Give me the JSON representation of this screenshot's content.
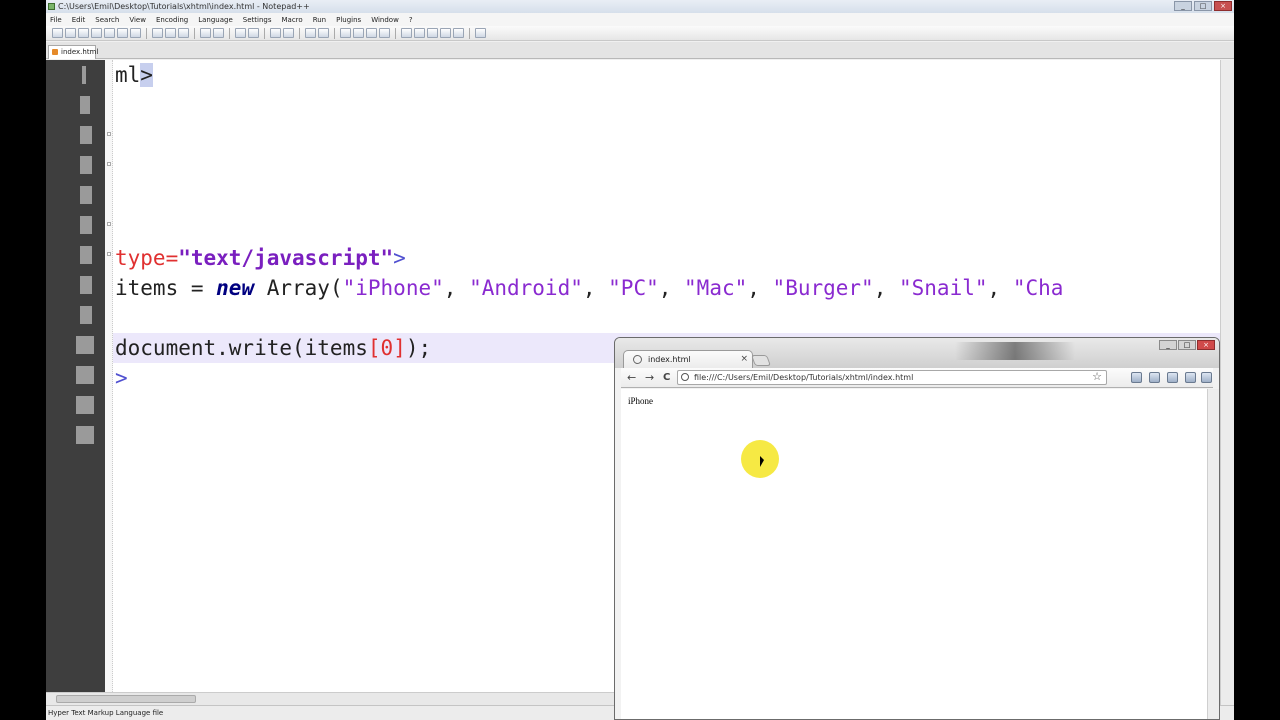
{
  "npp": {
    "title": "C:\\Users\\Emil\\Desktop\\Tutorials\\xhtml\\index.html - Notepad++",
    "menu": [
      "File",
      "Edit",
      "Search",
      "View",
      "Encoding",
      "Language",
      "Settings",
      "Macro",
      "Run",
      "Plugins",
      "Window",
      "?"
    ],
    "tab": "index.html",
    "status": "Hyper Text Markup Language file"
  },
  "code": {
    "l1_a": "ml",
    "l1_b": ">",
    "l2_a": "type=",
    "l2_b": "\"text/javascript\"",
    "l2_c": ">",
    "l3_a": "items = ",
    "l3_b": "new",
    "l3_c": " Array(",
    "l3_d": "\"iPhone\"",
    "l3_e": ", ",
    "l3_f": "\"Android\"",
    "l3_g": ", ",
    "l3_h": "\"PC\"",
    "l3_i": ", ",
    "l3_j": "\"Mac\"",
    "l3_k": ", ",
    "l3_l": "\"Burger\"",
    "l3_m": ", ",
    "l3_n": "\"Snail\"",
    "l3_o": ", ",
    "l3_p": "\"Cha",
    "l4_a": "document.write(items",
    "l4_b": "[",
    "l4_c": "0",
    "l4_d": "]",
    "l4_e": ");",
    "l5_a": ">"
  },
  "chrome": {
    "tab_title": "index.html",
    "tab_close": "×",
    "url": "file:///C:/Users/Emil/Desktop/Tutorials/xhtml/index.html",
    "page_text": "iPhone",
    "star": "☆",
    "back": "←",
    "forward": "→",
    "reload": "C"
  }
}
